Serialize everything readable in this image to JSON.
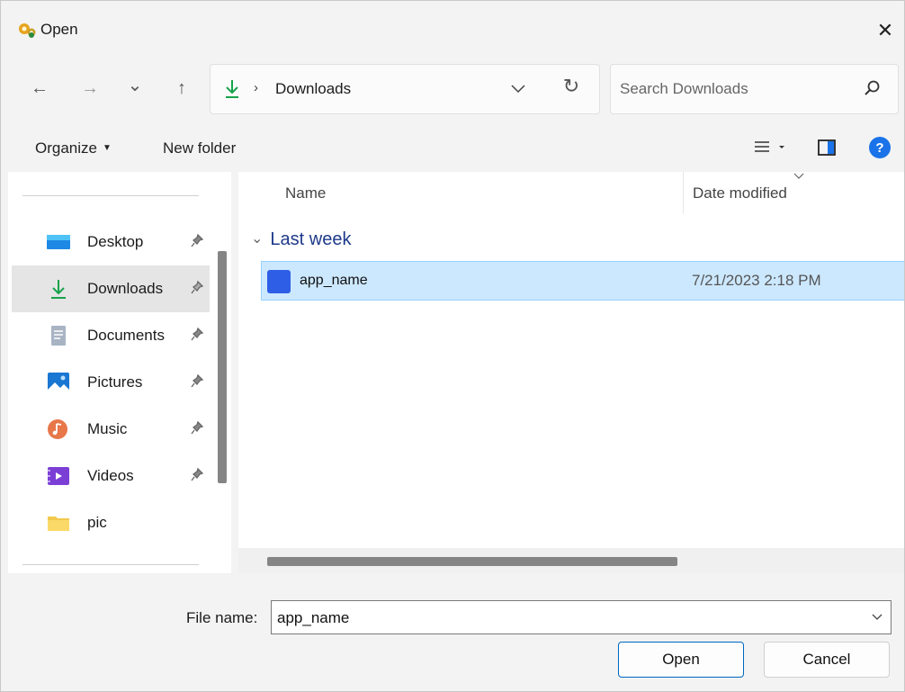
{
  "window": {
    "title": "Open",
    "close_glyph": "✕"
  },
  "nav": {
    "back_glyph": "←",
    "forward_glyph": "→",
    "recent_glyph": "⌄",
    "up_glyph": "↑"
  },
  "address": {
    "separator": "›",
    "current": "Downloads",
    "refresh_glyph": "↻"
  },
  "search": {
    "placeholder": "Search Downloads"
  },
  "commands": {
    "organize": "Organize",
    "organize_caret": "▼",
    "new_folder": "New folder"
  },
  "sidebar": {
    "items": [
      {
        "label": "Desktop",
        "icon": "desktop-icon",
        "pinned": true
      },
      {
        "label": "Downloads",
        "icon": "downloads-icon",
        "pinned": true,
        "active": true
      },
      {
        "label": "Documents",
        "icon": "documents-icon",
        "pinned": true
      },
      {
        "label": "Pictures",
        "icon": "pictures-icon",
        "pinned": true
      },
      {
        "label": "Music",
        "icon": "music-icon",
        "pinned": true
      },
      {
        "label": "Videos",
        "icon": "videos-icon",
        "pinned": true
      },
      {
        "label": "pic",
        "icon": "folder-icon",
        "pinned": false
      }
    ]
  },
  "filelist": {
    "columns": {
      "name": "Name",
      "date": "Date modified"
    },
    "group": {
      "chevron": "⌄",
      "label": "Last week"
    },
    "files": [
      {
        "name": "app_name",
        "date": "7/21/2023 2:18 PM",
        "selected": true
      }
    ]
  },
  "bottom": {
    "file_name_label": "File name:",
    "file_name_value": "app_name",
    "open_label": "Open",
    "cancel_label": "Cancel"
  },
  "colors": {
    "accent": "#0067c0",
    "selection": "#cce8ff",
    "help": "#1a73e8"
  }
}
